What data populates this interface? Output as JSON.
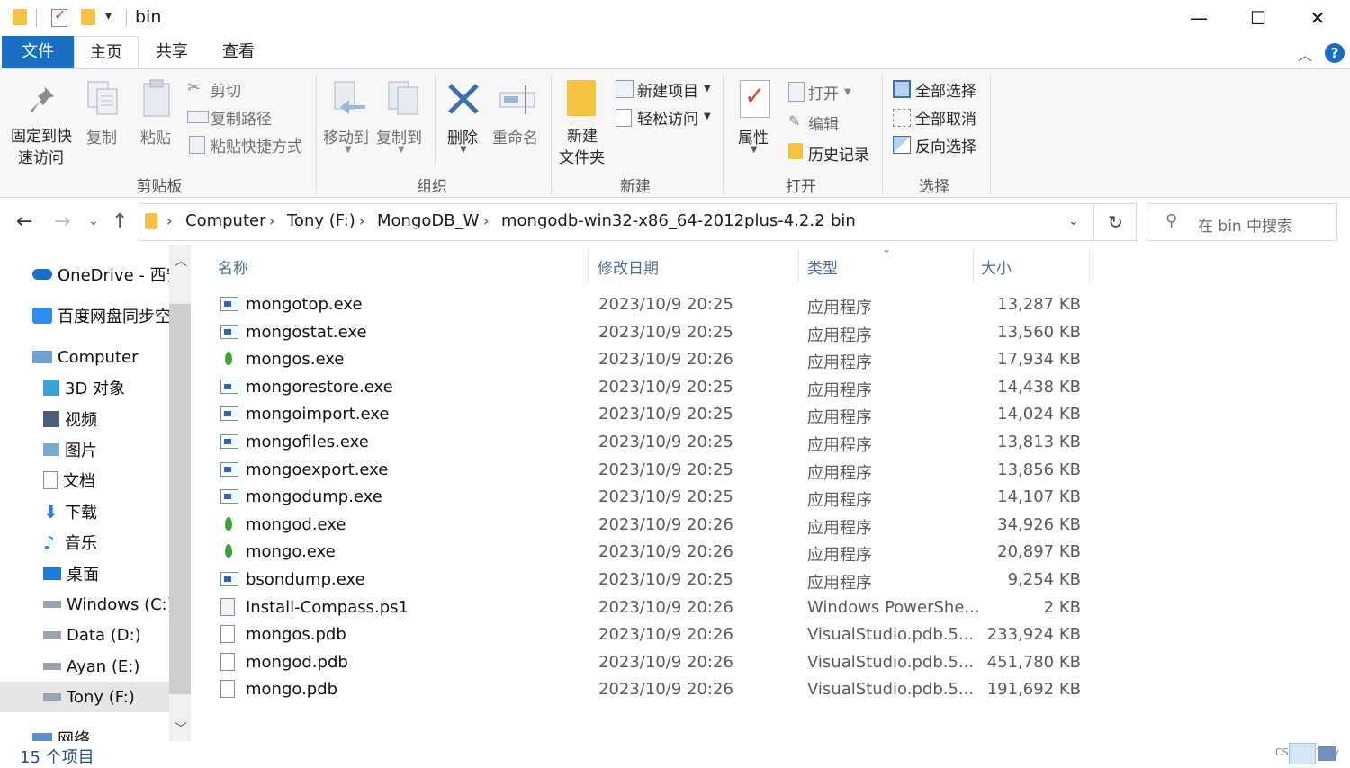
{
  "window": {
    "title": "bin",
    "minimize": "—",
    "maximize": "☐",
    "close": "✕"
  },
  "tabs": [
    "文件",
    "主页",
    "共享",
    "查看"
  ],
  "help": "?",
  "ribbon": {
    "clipboard": {
      "pin": "固定到快",
      "pin2": "速访问",
      "copy": "复制",
      "paste": "粘贴",
      "cut": "剪切",
      "copy_path": "复制路径",
      "paste_shortcut": "粘贴快捷方式",
      "label": "剪贴板"
    },
    "organize": {
      "move_to": "移动到",
      "copy_to": "复制到",
      "delete": "删除",
      "rename": "重命名",
      "label": "组织"
    },
    "new": {
      "new_folder": "新建",
      "new_folder2": "文件夹",
      "new_item": "新建项目",
      "easy_access": "轻松访问",
      "label": "新建"
    },
    "open": {
      "properties": "属性",
      "open": "打开",
      "edit": "编辑",
      "history": "历史记录",
      "label": "打开"
    },
    "select": {
      "select_all": "全部选择",
      "select_none": "全部取消",
      "invert": "反向选择",
      "label": "选择"
    }
  },
  "address": {
    "crumbs": [
      "Computer",
      "Tony (F:)",
      "MongoDB_W",
      "mongodb-win32-x86_64-2012plus-4.2.2",
      "bin"
    ],
    "search_placeholder": "在 bin 中搜索"
  },
  "nav": {
    "items": [
      {
        "label": "OneDrive - 西安",
        "icon": "cloud-icon"
      },
      {
        "label": "百度网盘同步空",
        "icon": "baidu-icon"
      },
      {
        "label": "Computer",
        "icon": "computer-icon"
      },
      {
        "label": "3D 对象",
        "icon": "cube-icon"
      },
      {
        "label": "视频",
        "icon": "video-icon"
      },
      {
        "label": "图片",
        "icon": "picture-icon"
      },
      {
        "label": "文档",
        "icon": "document-icon"
      },
      {
        "label": "下载",
        "icon": "download-icon"
      },
      {
        "label": "音乐",
        "icon": "music-icon"
      },
      {
        "label": "桌面",
        "icon": "desktop-icon"
      },
      {
        "label": "Windows (C:)",
        "icon": "drive-icon"
      },
      {
        "label": "Data (D:)",
        "icon": "drive-icon"
      },
      {
        "label": "Ayan (E:)",
        "icon": "drive-icon"
      },
      {
        "label": "Tony (F:)",
        "icon": "drive-icon"
      },
      {
        "label": "网络",
        "icon": "network-icon"
      }
    ]
  },
  "columns": {
    "name": "名称",
    "date": "修改日期",
    "type": "类型",
    "size": "大小"
  },
  "files": [
    {
      "name": "mongotop.exe",
      "date": "2023/10/9 20:25",
      "type": "应用程序",
      "size": "13,287 KB",
      "icon": "exe"
    },
    {
      "name": "mongostat.exe",
      "date": "2023/10/9 20:25",
      "type": "应用程序",
      "size": "13,560 KB",
      "icon": "exe"
    },
    {
      "name": "mongos.exe",
      "date": "2023/10/9 20:26",
      "type": "应用程序",
      "size": "17,934 KB",
      "icon": "mongo"
    },
    {
      "name": "mongorestore.exe",
      "date": "2023/10/9 20:25",
      "type": "应用程序",
      "size": "14,438 KB",
      "icon": "exe"
    },
    {
      "name": "mongoimport.exe",
      "date": "2023/10/9 20:25",
      "type": "应用程序",
      "size": "14,024 KB",
      "icon": "exe"
    },
    {
      "name": "mongofiles.exe",
      "date": "2023/10/9 20:25",
      "type": "应用程序",
      "size": "13,813 KB",
      "icon": "exe"
    },
    {
      "name": "mongoexport.exe",
      "date": "2023/10/9 20:25",
      "type": "应用程序",
      "size": "13,856 KB",
      "icon": "exe"
    },
    {
      "name": "mongodump.exe",
      "date": "2023/10/9 20:25",
      "type": "应用程序",
      "size": "14,107 KB",
      "icon": "exe"
    },
    {
      "name": "mongod.exe",
      "date": "2023/10/9 20:26",
      "type": "应用程序",
      "size": "34,926 KB",
      "icon": "mongo"
    },
    {
      "name": "mongo.exe",
      "date": "2023/10/9 20:26",
      "type": "应用程序",
      "size": "20,897 KB",
      "icon": "mongo"
    },
    {
      "name": "bsondump.exe",
      "date": "2023/10/9 20:25",
      "type": "应用程序",
      "size": "9,254 KB",
      "icon": "exe"
    },
    {
      "name": "Install-Compass.ps1",
      "date": "2023/10/9 20:26",
      "type": "Windows PowerShe...",
      "size": "2 KB",
      "icon": "ps"
    },
    {
      "name": "mongos.pdb",
      "date": "2023/10/9 20:26",
      "type": "VisualStudio.pdb.5...",
      "size": "233,924 KB",
      "icon": "pdb"
    },
    {
      "name": "mongod.pdb",
      "date": "2023/10/9 20:26",
      "type": "VisualStudio.pdb.5...",
      "size": "451,780 KB",
      "icon": "pdb"
    },
    {
      "name": "mongo.pdb",
      "date": "2023/10/9 20:26",
      "type": "VisualStudio.pdb.5...",
      "size": "191,692 KB",
      "icon": "pdb"
    }
  ],
  "status": {
    "count": "15 个项目"
  },
  "watermark": "CSDN @Tony",
  "colors": {
    "accent": "#1a6ec4",
    "header": "#4c6e9a",
    "selected": "#e5e5e5"
  }
}
